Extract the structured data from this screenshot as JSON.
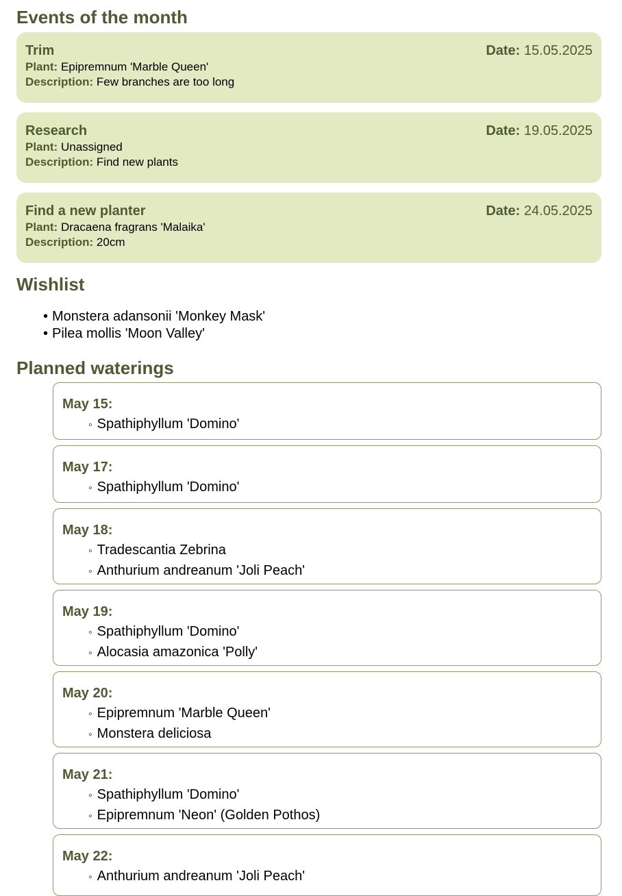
{
  "events_section": {
    "title": "Events of the month",
    "date_label": "Date:",
    "plant_label": "Plant:",
    "description_label": "Description:",
    "events": [
      {
        "name": "Trim",
        "date": "15.05.2025",
        "plant": "Epipremnum 'Marble Queen'",
        "description": "Few branches are too long"
      },
      {
        "name": "Research",
        "date": "19.05.2025",
        "plant": "Unassigned",
        "description": "Find new plants"
      },
      {
        "name": "Find a new planter",
        "date": "24.05.2025",
        "plant": "Dracaena fragrans 'Malaika'",
        "description": "20cm"
      }
    ]
  },
  "wishlist": {
    "title": "Wishlist",
    "items": [
      "Monstera adansonii 'Monkey Mask'",
      "Pilea mollis 'Moon Valley'"
    ]
  },
  "waterings": {
    "title": "Planned waterings",
    "days": [
      {
        "date": "May 15:",
        "plants": [
          "Spathiphyllum 'Domino'"
        ]
      },
      {
        "date": "May 17:",
        "plants": [
          "Spathiphyllum 'Domino'"
        ]
      },
      {
        "date": "May 18:",
        "plants": [
          "Tradescantia Zebrina",
          "Anthurium andreanum 'Joli Peach'"
        ]
      },
      {
        "date": "May 19:",
        "plants": [
          "Spathiphyllum 'Domino'",
          "Alocasia amazonica 'Polly'"
        ]
      },
      {
        "date": "May 20:",
        "plants": [
          "Epipremnum 'Marble Queen'",
          "Monstera deliciosa"
        ]
      },
      {
        "date": "May 21:",
        "plants": [
          "Spathiphyllum 'Domino'",
          "Epipremnum 'Neon' (Golden Pothos)"
        ]
      },
      {
        "date": "May 22:",
        "plants": [
          "Anthurium andreanum 'Joli Peach'"
        ]
      }
    ]
  }
}
